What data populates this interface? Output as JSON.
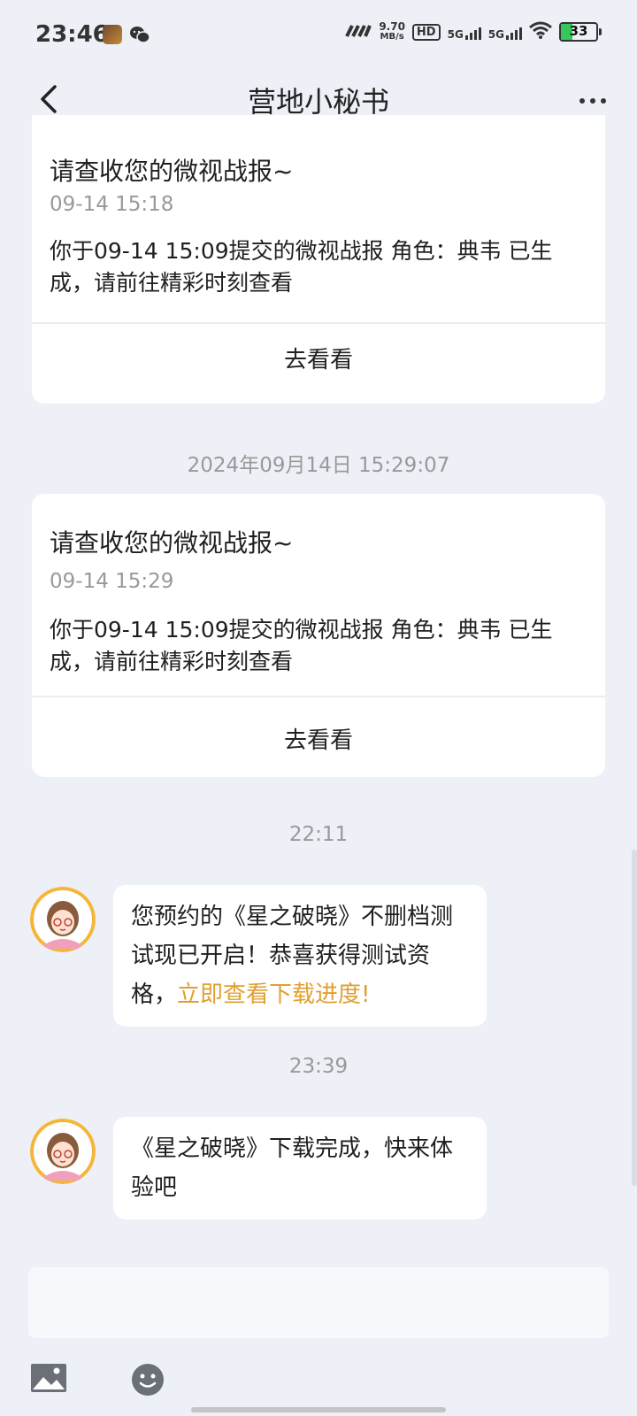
{
  "status_bar": {
    "time": "23:46",
    "net_speed": "9.70",
    "net_unit": "MB/s",
    "hd_label": "HD",
    "sim1": "5G",
    "sim2": "5G",
    "battery": "33",
    "battery_level": 0.33,
    "battery_color": "#34c759"
  },
  "header": {
    "title": "营地小秘书",
    "back_icon": "chevron-left-icon",
    "more_icon": "more-horizontal-icon"
  },
  "cards": [
    {
      "title": "请查收您的微视战报~",
      "time": "09-14 15:18",
      "body": "你于09-14 15:09提交的微视战报 角色：典韦 已生成，请前往精彩时刻查看",
      "action": "去看看"
    },
    {
      "title": "请查收您的微视战报~",
      "time": "09-14 15:29",
      "body": "你于09-14 15:09提交的微视战报 角色：典韦 已生成，请前往精彩时刻查看",
      "action": "去看看"
    }
  ],
  "timestamps": [
    "2024年09月14日 15:29:07",
    "22:11",
    "23:39"
  ],
  "messages": [
    {
      "text": "您预约的《星之破晓》不删档测试现已开启！恭喜获得测试资格，",
      "link": "立即查看下载进度!"
    },
    {
      "text": "《星之破晓》下载完成，快来体验吧"
    }
  ],
  "input": {
    "placeholder": "",
    "image_icon": "image-icon",
    "emoji_icon": "emoji-icon"
  },
  "colors": {
    "background": "#eef0f7",
    "link": "#e0a030",
    "avatar_bg": "#f5b638"
  }
}
